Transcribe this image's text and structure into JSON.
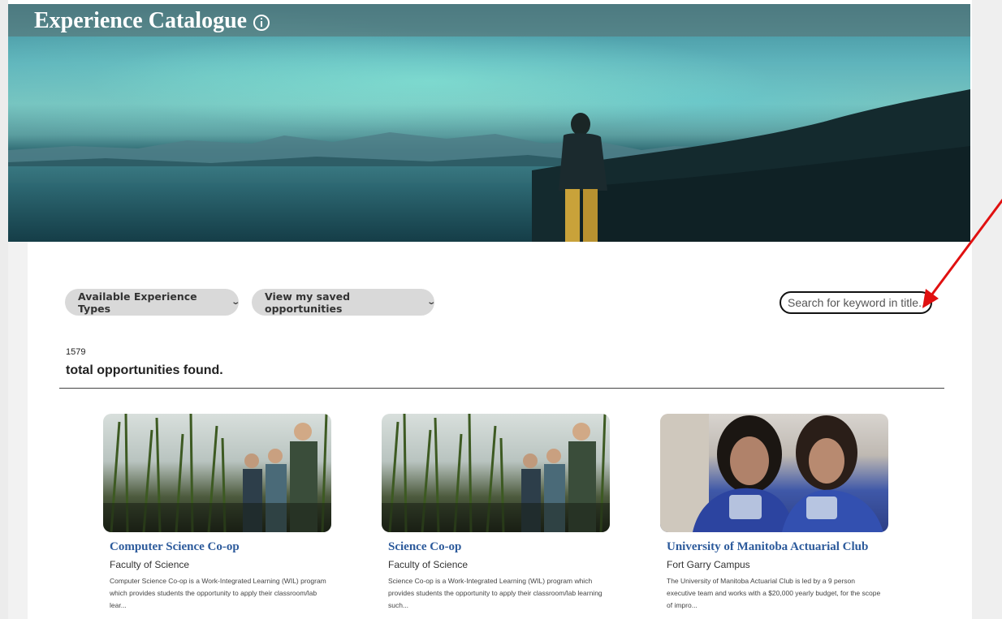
{
  "header": {
    "title": "Experience Catalogue",
    "info_icon": "info-circle-icon"
  },
  "filters": {
    "types_label": "Available Experience Types",
    "saved_label": "View my saved opportunities",
    "chevron": "⌄"
  },
  "search": {
    "placeholder": "Search for keyword in title..."
  },
  "results": {
    "count": "1579",
    "count_label": "total opportunities found."
  },
  "cards": [
    {
      "title": "Computer Science Co-op",
      "subtitle": "Faculty of Science",
      "description": "Computer Science Co-op is a Work-Integrated Learning (WIL) program which provides students the opportunity to apply their classroom/lab lear..."
    },
    {
      "title": "Science Co-op",
      "subtitle": "Faculty of Science",
      "description": "Science Co-op is a Work-Integrated Learning (WIL) program which provides students the opportunity to apply their classroom/lab learning such..."
    },
    {
      "title": "University of Manitoba Actuarial Club",
      "subtitle": "Fort Garry Campus",
      "description": "The University of Manitoba Actuarial Club is led by a 9 person executive team and works with a $20,000 yearly budget, for the scope of impro..."
    }
  ],
  "colors": {
    "title_link": "#2c5a9b",
    "pill_bg": "#d9d9d9",
    "annotation_arrow": "#e01010"
  }
}
